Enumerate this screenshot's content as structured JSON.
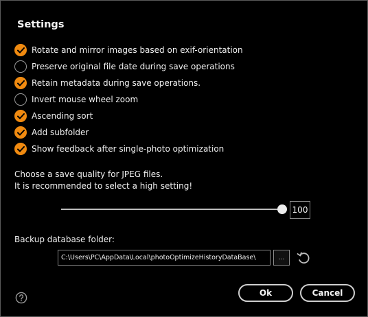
{
  "dialog": {
    "title": "Settings"
  },
  "options": [
    {
      "label": "Rotate and mirror images based on exif-orientation",
      "checked": true
    },
    {
      "label": "Preserve original file date during save operations",
      "checked": false
    },
    {
      "label": "Retain metadata during save operations.",
      "checked": true
    },
    {
      "label": "Invert mouse wheel zoom",
      "checked": false
    },
    {
      "label": "Ascending sort",
      "checked": true
    },
    {
      "label": "Add subfolder",
      "checked": true
    },
    {
      "label": "Show feedback after single-photo optimization",
      "checked": true
    }
  ],
  "quality": {
    "line1": "Choose a save quality for JPEG files.",
    "line2": "It is recommended to select a high setting!",
    "value": "100",
    "min": 0,
    "max": 100
  },
  "backup": {
    "label": "Backup database folder:",
    "path": "C:\\Users\\PC\\AppData\\Local\\photoOptimizeHistoryDataBase\\",
    "browse_label": "..."
  },
  "buttons": {
    "ok": "Ok",
    "cancel": "Cancel"
  },
  "colors": {
    "accent": "#f08a10",
    "background": "#000000",
    "text": "#f0f0f0"
  },
  "icons": {
    "check": "check-icon",
    "reset": "reset-arrow-icon",
    "help": "help-question-icon"
  }
}
